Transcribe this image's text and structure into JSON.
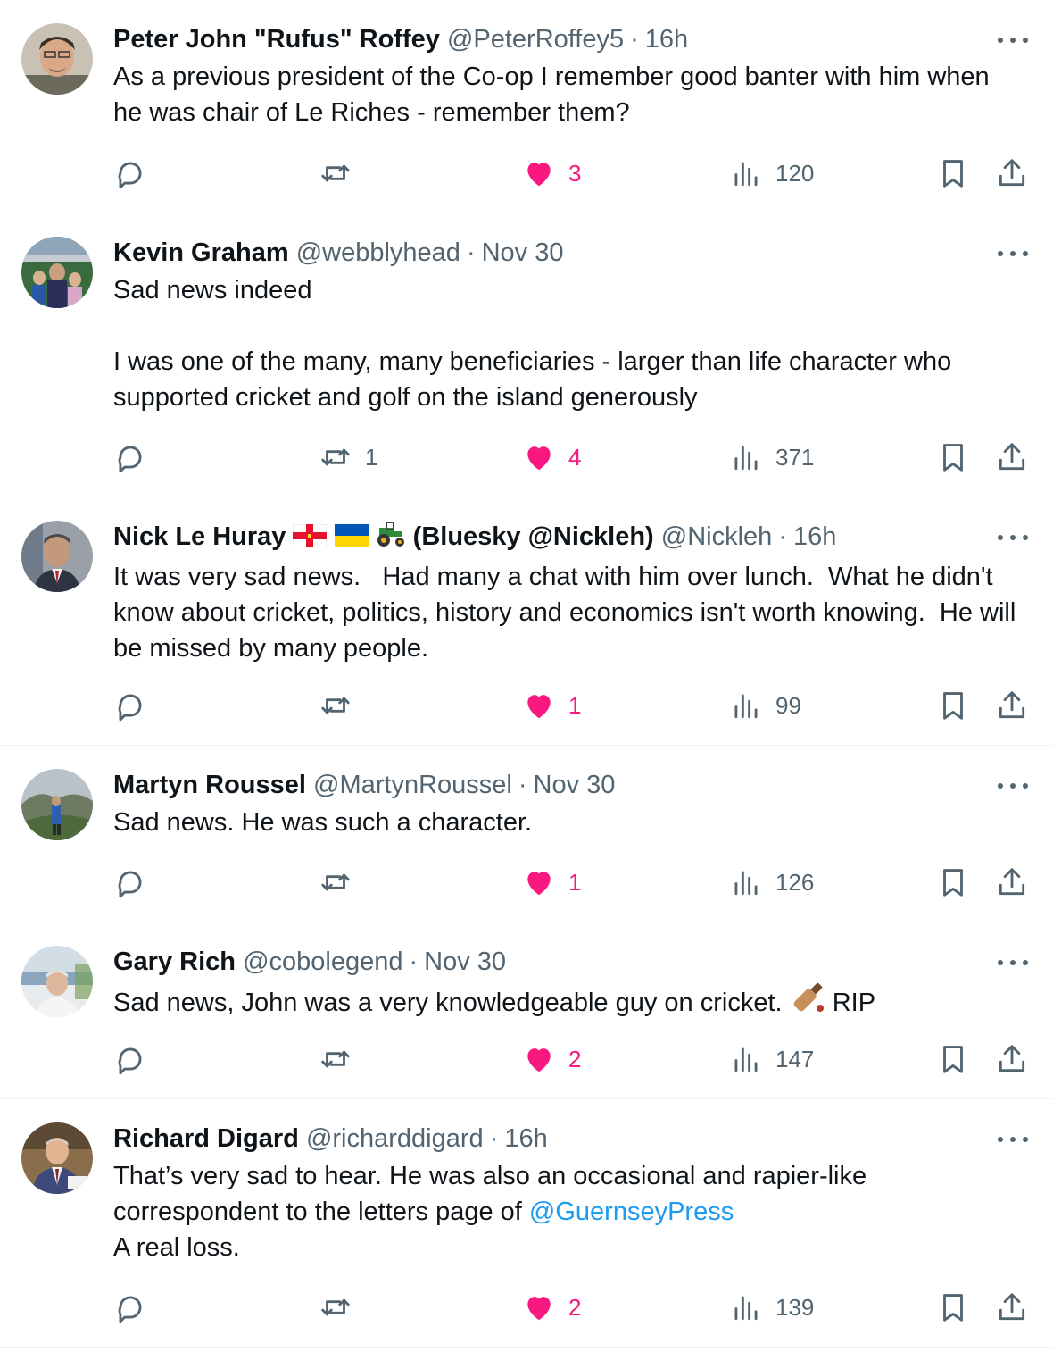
{
  "colors": {
    "text": "#0f1419",
    "muted": "#536471",
    "like": "#f91880",
    "link": "#1d9bf0",
    "divider": "#eff3f4"
  },
  "icons": [
    "reply-icon",
    "retweet-icon",
    "heart-icon",
    "views-icon",
    "bookmark-icon",
    "share-icon",
    "more-icon"
  ],
  "replies": [
    {
      "name": "Peter John \"Rufus\" Roffey",
      "handle": "@PeterRoffey5",
      "separator": "·",
      "time": "16h",
      "text": "As a previous president of the Co-op I remember good banter with him when he was chair of Le Riches - remember them?",
      "retweets": "",
      "likes": "3",
      "views": "120"
    },
    {
      "name": "Kevin Graham",
      "handle": "@webblyhead",
      "separator": "·",
      "time": "Nov 30",
      "text": "Sad news indeed\n\nI was one of the many, many beneficiaries - larger than life character who supported cricket and golf on the island generously",
      "retweets": "1",
      "likes": "4",
      "views": "371"
    },
    {
      "name": "Nick Le Huray",
      "name_suffix": "(Bluesky @Nickleh)",
      "name_emoji": [
        "guernsey-flag-icon",
        "ukraine-flag-icon",
        "tractor-icon"
      ],
      "handle": "@Nickleh",
      "separator": "·",
      "time": "16h",
      "text": "It was very sad news.   Had many a chat with him over lunch.  What he didn't know about cricket, politics, history and economics isn't worth knowing.  He will be missed by many people.",
      "retweets": "",
      "likes": "1",
      "views": "99"
    },
    {
      "name": "Martyn Roussel",
      "handle": "@MartynRoussel",
      "separator": "·",
      "time": "Nov 30",
      "text": "Sad news. He was such a character.",
      "retweets": "",
      "likes": "1",
      "views": "126"
    },
    {
      "name": "Gary Rich",
      "handle": "@cobolegend",
      "separator": "·",
      "time": "Nov 30",
      "text_before_emoji": "Sad news, John was a very knowledgeable guy on cricket.",
      "text_emoji": "cricket-bat-icon",
      "text_after_emoji": "RIP",
      "retweets": "",
      "likes": "2",
      "views": "147"
    },
    {
      "name": "Richard Digard",
      "handle": "@richarddigard",
      "separator": "·",
      "time": "16h",
      "text_before_mention": "That’s very sad to hear. He was also an occasional and rapier-like correspondent to the letters page of ",
      "mention": "@GuernseyPress",
      "text_after_mention": "\nA real loss.",
      "retweets": "",
      "likes": "2",
      "views": "139"
    }
  ]
}
